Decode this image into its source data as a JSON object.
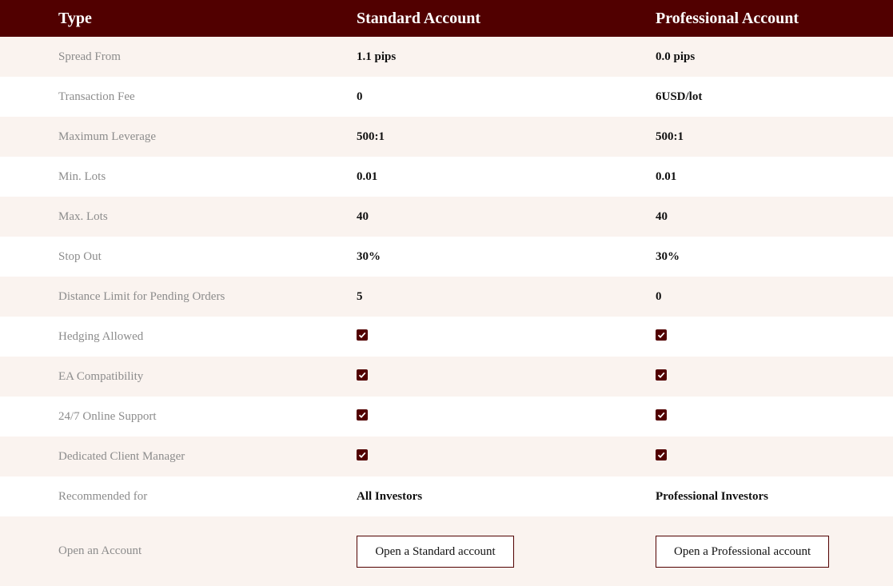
{
  "header": {
    "type_label": "Type",
    "standard_label": "Standard Account",
    "professional_label": "Professional Account"
  },
  "rows": [
    {
      "label": "Spread From",
      "standard": "1.1 pips",
      "professional": "0.0 pips"
    },
    {
      "label": "Transaction Fee",
      "standard": "0",
      "professional": "6USD/lot"
    },
    {
      "label": "Maximum Leverage",
      "standard": "500:1",
      "professional": "500:1"
    },
    {
      "label": "Min. Lots",
      "standard": "0.01",
      "professional": "0.01"
    },
    {
      "label": "Max. Lots",
      "standard": "40",
      "professional": "40"
    },
    {
      "label": "Stop Out",
      "standard": "30%",
      "professional": "30%"
    },
    {
      "label": "Distance Limit for Pending Orders",
      "standard": "5",
      "professional": "0"
    },
    {
      "label": "Hedging Allowed",
      "standard": "check",
      "professional": "check"
    },
    {
      "label": "EA Compatibility",
      "standard": "check",
      "professional": "check"
    },
    {
      "label": "24/7 Online Support",
      "standard": "check",
      "professional": "check"
    },
    {
      "label": "Dedicated Client Manager",
      "standard": "check",
      "professional": "check"
    },
    {
      "label": "Recommended for",
      "standard": "All Investors",
      "professional": "Professional Investors"
    }
  ],
  "open_account": {
    "label": "Open an Account",
    "standard_button": "Open a Standard account",
    "professional_button": "Open a Professional account"
  },
  "colors": {
    "header_bg": "#510000",
    "alt_row_bg": "#faf3ef",
    "check_bg": "#510000"
  }
}
